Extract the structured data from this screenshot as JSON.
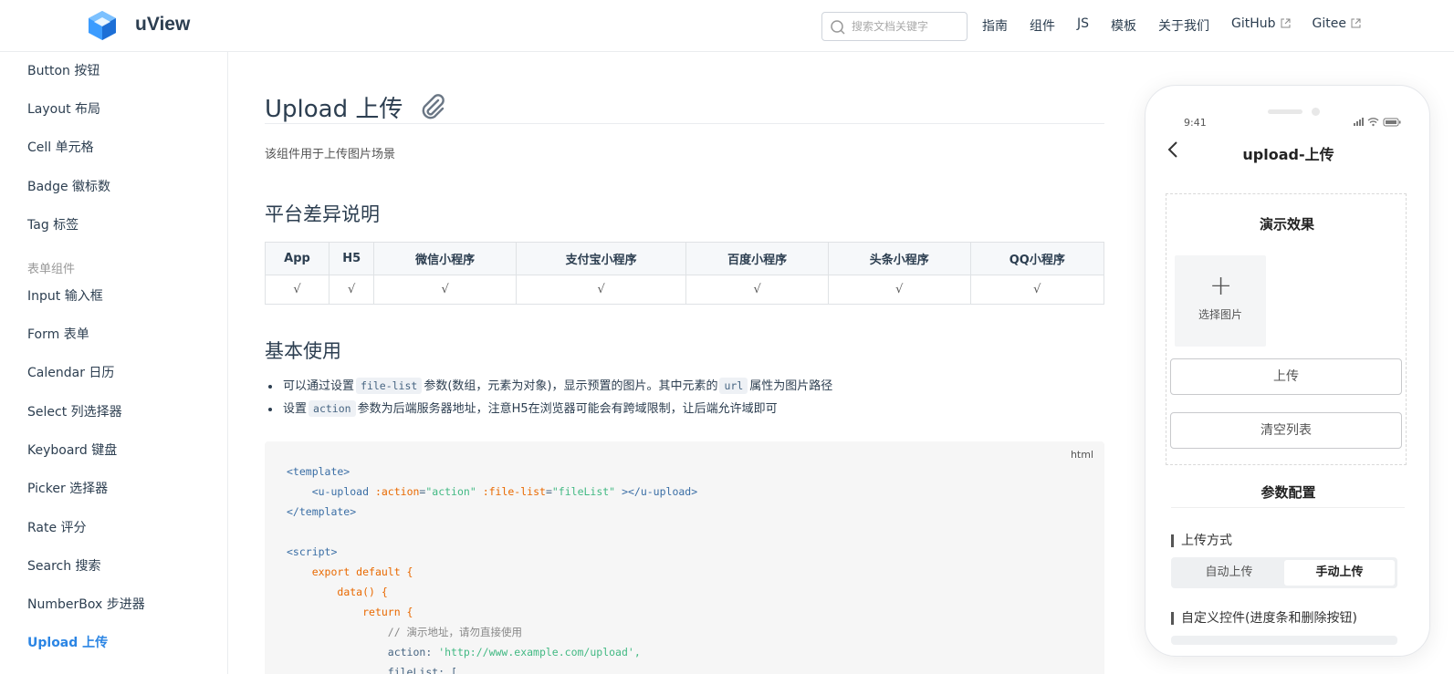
{
  "header": {
    "brand": "uView",
    "search_placeholder": "搜索文档关键字",
    "nav": [
      "指南",
      "组件",
      "JS",
      "模板",
      "关于我们",
      "GitHub",
      "Gitee"
    ]
  },
  "sidebar": {
    "items_top": [
      "Button 按钮",
      "Layout 布局",
      "Cell 单元格",
      "Badge 徽标数",
      "Tag 标签"
    ],
    "group_label": "表单组件",
    "items_form": [
      "Input 输入框",
      "Form 表单",
      "Calendar 日历",
      "Select 列选择器",
      "Keyboard 键盘",
      "Picker 选择器",
      "Rate 评分",
      "Search 搜索",
      "NumberBox 步进器",
      "Upload 上传"
    ],
    "active": "Upload 上传"
  },
  "main": {
    "title": "Upload 上传",
    "intro": "该组件用于上传图片场景",
    "section_platform": "平台差异说明",
    "platform_headers": [
      "App",
      "H5",
      "微信小程序",
      "支付宝小程序",
      "百度小程序",
      "头条小程序",
      "QQ小程序"
    ],
    "platform_values": [
      "√",
      "√",
      "√",
      "√",
      "√",
      "√",
      "√"
    ],
    "section_basic": "基本使用",
    "bullet1": {
      "a": "可以通过设置",
      "code1": "file-list",
      "b": "参数(数组，元素为对象)，显示预置的图片。其中元素的",
      "code2": "url",
      "c": "属性为图片路径"
    },
    "bullet2": {
      "a": "设置",
      "code1": "action",
      "b": "参数为后端服务器地址，注意H5在浏览器可能会有跨域限制，让后端允许域即可"
    },
    "code_lang": "html",
    "code": {
      "l1": "<template>",
      "l2_tag_open": "<u-upload",
      "l2_attr1": ":action",
      "l2_val1": "\"action\"",
      "l2_attr2": ":file-list",
      "l2_val2": "\"fileList\"",
      "l2_close": "></u-upload>",
      "l3": "</template>",
      "l5": "<script>",
      "l6": "export default {",
      "l7": "data() {",
      "l8": "return {",
      "l9": "// 演示地址，请勿直接使用",
      "l10_key": "action:",
      "l10_val": "'http://www.example.com/upload',",
      "l11": "fileList: ["
    }
  },
  "phone": {
    "time": "9:41",
    "title": "upload-上传",
    "demo_title": "演示效果",
    "upload_tile_label": "选择图片",
    "btn_upload": "上传",
    "btn_clear": "清空列表",
    "config_title": "参数配置",
    "sec1": "上传方式",
    "seg_options": [
      "自动上传",
      "手动上传"
    ],
    "seg_selected": "手动上传",
    "sec2": "自定义控件(进度条和删除按钮)"
  },
  "colors": {
    "accent": "#2b85e4",
    "text": "#2c3e50",
    "code_bg": "#f6f6f6"
  }
}
